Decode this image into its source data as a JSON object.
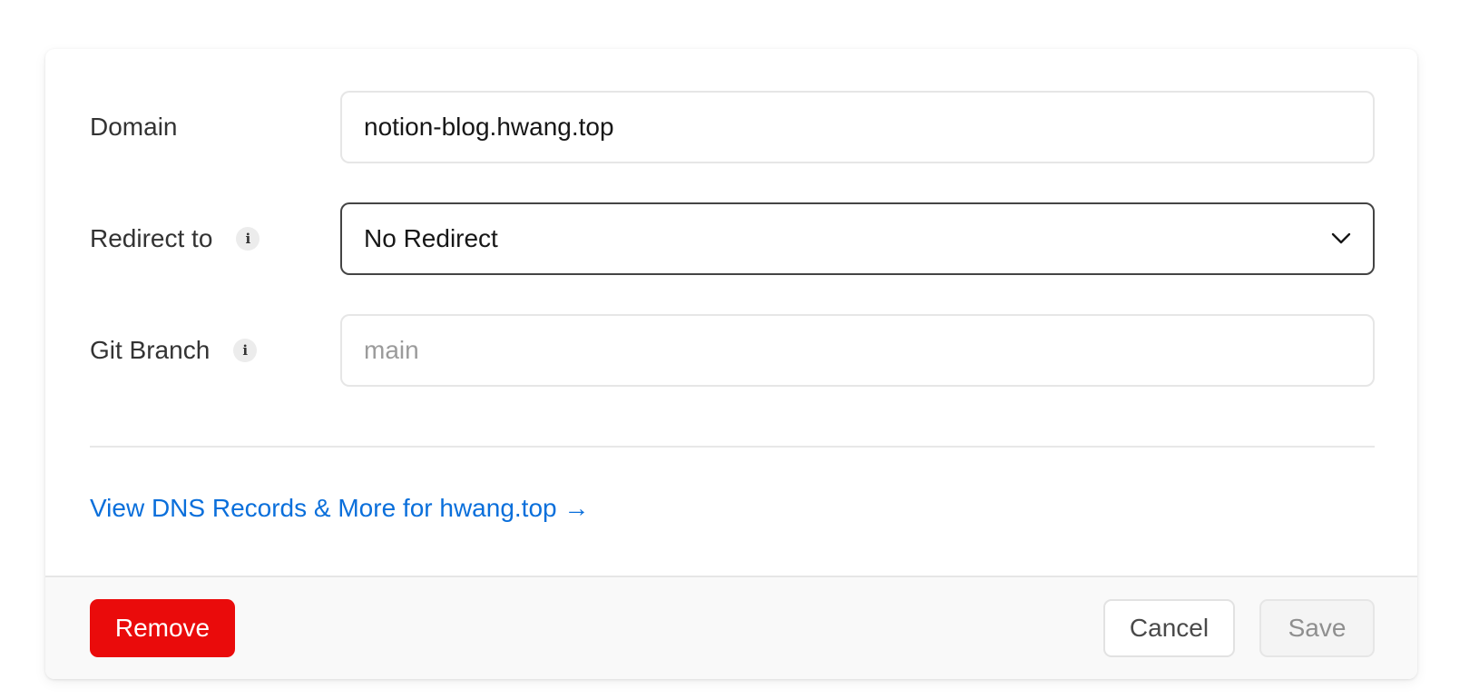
{
  "form": {
    "domain": {
      "label": "Domain",
      "value": "notion-blog.hwang.top"
    },
    "redirect": {
      "label": "Redirect to",
      "info_icon": "i",
      "selected": "No Redirect",
      "chevron_icon": "chevron-down-icon"
    },
    "git_branch": {
      "label": "Git Branch",
      "info_icon": "i",
      "placeholder": "main"
    }
  },
  "link": {
    "text": "View DNS Records & More for hwang.top →"
  },
  "footer": {
    "remove_label": "Remove",
    "cancel_label": "Cancel",
    "save_label": "Save"
  },
  "colors": {
    "link": "#0a6fdb",
    "danger": "#ea0b0b",
    "border": "#e6e6e6",
    "select_border": "#444444"
  }
}
